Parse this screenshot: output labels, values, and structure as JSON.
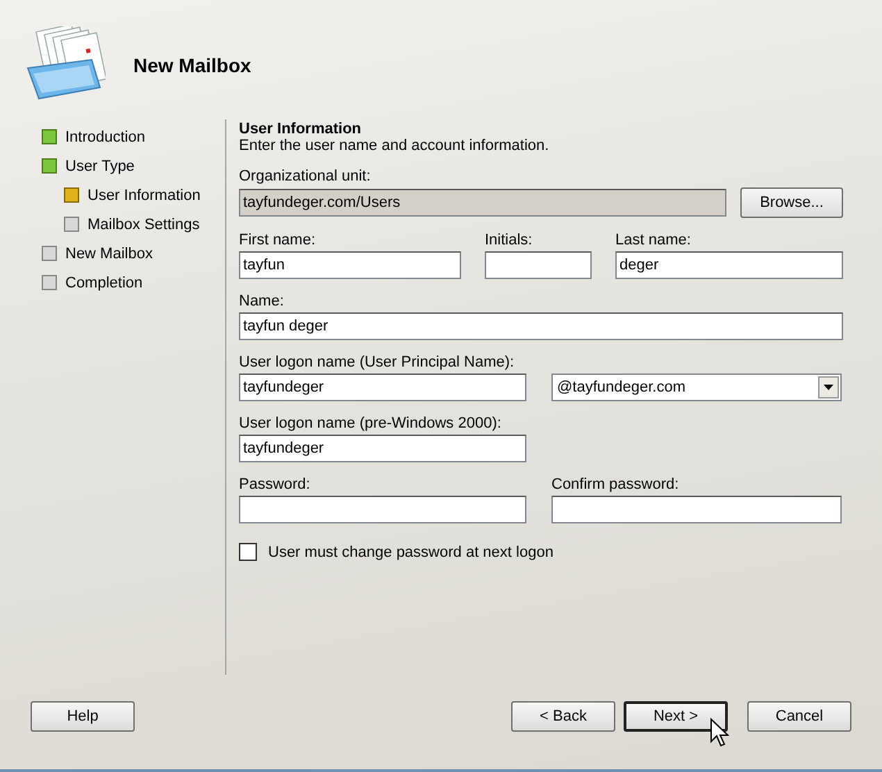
{
  "header": {
    "title": "New Mailbox"
  },
  "steps": [
    {
      "label": "Introduction",
      "completed": true,
      "current": false
    },
    {
      "label": "User Type",
      "completed": true,
      "current": false,
      "children": [
        {
          "label": "User Information",
          "completed": false,
          "current": true
        },
        {
          "label": "Mailbox Settings",
          "completed": false,
          "current": false
        }
      ]
    },
    {
      "label": "New Mailbox",
      "completed": false,
      "current": false
    },
    {
      "label": "Completion",
      "completed": false,
      "current": false
    }
  ],
  "section": {
    "title": "User Information",
    "description": "Enter the user name and account information."
  },
  "org_unit": {
    "label": "Organizational unit:",
    "value": "tayfundeger.com/Users",
    "disabled": true,
    "button": "Browse..."
  },
  "name_fields": [
    {
      "label": "First name:",
      "value": "tayfun"
    },
    {
      "label": "Initials:"
    },
    {
      "label": "Last name:",
      "value": "deger"
    }
  ],
  "name": {
    "label": "Name:",
    "value": "tayfun deger"
  },
  "upn": {
    "label": "User logon name (User Principal Name):",
    "value": "tayfundeger",
    "domain": "@tayfundeger.com"
  },
  "pre_win2000": {
    "label": "User logon name (pre-Windows 2000):",
    "value": "tayfundeger"
  },
  "passwords": [
    {
      "label": "Password:"
    },
    {
      "label": "Confirm password:"
    }
  ],
  "must_change": {
    "label": "User must change password at next logon",
    "checked": false
  },
  "buttons": [
    {
      "label": "Help",
      "kind": "help"
    },
    {
      "label": "< Back",
      "kind": "nav"
    },
    {
      "label": "Next >",
      "kind": "nav"
    },
    {
      "label": "Cancel",
      "kind": "cancel"
    }
  ]
}
